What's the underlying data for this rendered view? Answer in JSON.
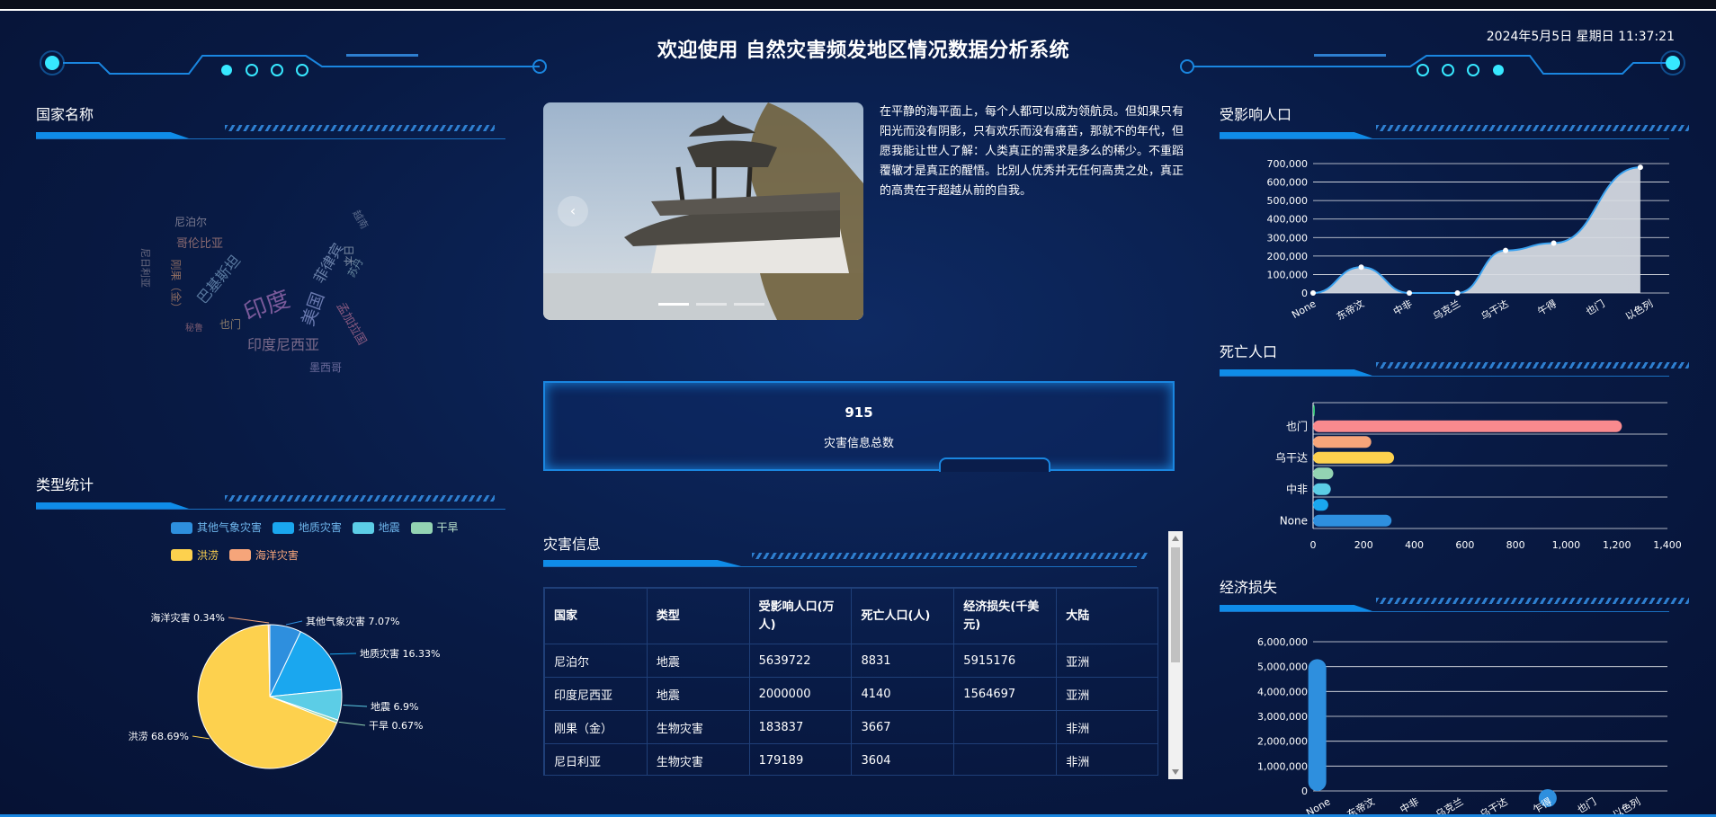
{
  "header": {
    "title": "欢迎使用 自然灾害频发地区情况数据分析系统",
    "datetime": "2024年5月5日 星期日 11:37:21"
  },
  "panels": {
    "country_title": "国家名称",
    "type_title": "类型统计",
    "affected_title": "受影响人口",
    "death_title": "死亡人口",
    "loss_title": "经济损失",
    "disaster_title": "灾害信息"
  },
  "wordcloud": [
    {
      "text": "印度",
      "color": "#7a5a9a"
    },
    {
      "text": "美国",
      "color": "#6a7ab0"
    },
    {
      "text": "印度尼西亚",
      "color": "#7a6a8a"
    },
    {
      "text": "菲律宾",
      "color": "#6a80a8"
    },
    {
      "text": "孟加拉国",
      "color": "#8a5a80"
    },
    {
      "text": "巴基斯坦",
      "color": "#5a7aa0"
    },
    {
      "text": "尼泊尔",
      "color": "#7a7a90"
    },
    {
      "text": "哥伦比亚",
      "color": "#8a6a70"
    },
    {
      "text": "墨西哥",
      "color": "#6a6a9a"
    },
    {
      "text": "也门",
      "color": "#8a7a6a"
    },
    {
      "text": "日本",
      "color": "#7a8aa0"
    },
    {
      "text": "苏丹",
      "color": "#6a8aa0"
    },
    {
      "text": "尼日利亚",
      "color": "#6a6a80"
    },
    {
      "text": "刚果（金）",
      "color": "#8a6a60"
    },
    {
      "text": "秘鲁",
      "color": "#7a5a70"
    },
    {
      "text": "越南",
      "color": "#5a6a8a"
    }
  ],
  "slide": {
    "text": "在平静的海平面上，每个人都可以成为领航员。但如果只有阳光而没有阴影，只有欢乐而没有痛苦，那就不的年代，但愿我能让世人了解：人类真正的需求是多么的稀少。不重蹈覆辙才是真正的醒悟。比别人优秀并无任何高贵之处，真正的高贵在于超越从前的自我。",
    "prev": "‹"
  },
  "counter": {
    "value": "915",
    "label": "灾害信息总数"
  },
  "table": {
    "headers": [
      "国家",
      "类型",
      "受影响人口(万人)",
      "死亡人口(人)",
      "经济损失(千美元)",
      "大陆"
    ],
    "rows": [
      [
        "尼泊尔",
        "地震",
        "5639722",
        "8831",
        "5915176",
        "亚洲"
      ],
      [
        "印度尼西亚",
        "地震",
        "2000000",
        "4140",
        "1564697",
        "亚洲"
      ],
      [
        "刚果（金）",
        "生物灾害",
        "183837",
        "3667",
        "",
        "非洲"
      ],
      [
        "尼日利亚",
        "生物灾害",
        "179189",
        "3604",
        "",
        "非洲"
      ]
    ]
  },
  "chart_data": [
    {
      "type": "pie",
      "title": "类型统计",
      "categories": [
        "其他气象灾害",
        "地质灾害",
        "地震",
        "干旱",
        "洪涝",
        "海洋灾害"
      ],
      "values": [
        7.07,
        16.33,
        6.9,
        0.67,
        68.69,
        0.34
      ],
      "labels": [
        "其他气象灾害 7.07%",
        "地质灾害 16.33%",
        "地震 6.9%",
        "干旱 0.67%",
        "洪涝 68.69%",
        "海洋灾害 0.34%"
      ],
      "colors": [
        "#2e8fde",
        "#1aa7ef",
        "#5ccde6",
        "#93d3b3",
        "#fdd14e",
        "#f6a57a"
      ],
      "legend_position": "top"
    },
    {
      "type": "area",
      "title": "受影响人口",
      "categories": [
        "None",
        "东帝汶",
        "中非",
        "乌克兰",
        "乌干达",
        "也门",
        "以色列"
      ],
      "x": [
        0,
        1,
        2,
        3,
        4,
        5,
        6,
        7,
        8,
        9
      ],
      "x_label_indices": [
        0,
        1,
        2,
        3,
        4,
        5,
        6,
        7
      ],
      "x_labels": [
        "None",
        "东帝汶",
        "中非",
        "乌克兰",
        "乌干达",
        "午得",
        "也门",
        "以色列"
      ],
      "values": [
        0,
        140000,
        0,
        0,
        230000,
        270000,
        680000
      ],
      "point_x": [
        0,
        1,
        2,
        3,
        4,
        5,
        6
      ],
      "ylim": [
        0,
        700000
      ],
      "yticks": [
        "0",
        "100,000",
        "200,000",
        "300,000",
        "400,000",
        "500,000",
        "600,000",
        "700,000"
      ],
      "grid": true
    },
    {
      "type": "bar",
      "orientation": "horizontal",
      "title": "死亡人口",
      "categories": [
        "None",
        "",
        "中非",
        "",
        "乌干达",
        "",
        "也门",
        ""
      ],
      "values": [
        310,
        60,
        70,
        80,
        320,
        230,
        1220,
        5
      ],
      "colors": [
        "#2e8fde",
        "#1aa7ef",
        "#5ccde6",
        "#93d3b3",
        "#fdd14e",
        "#f6a57a",
        "#f98a8e",
        "#37c97a"
      ],
      "xlim": [
        0,
        1400
      ],
      "xticks": [
        "0",
        "200",
        "400",
        "600",
        "800",
        "1,000",
        "1,200",
        "1,400"
      ],
      "grid": true
    },
    {
      "type": "bar",
      "title": "经济损失",
      "categories": [
        "None",
        "东帝汶",
        "中非",
        "乌克兰",
        "乌干达",
        "乍得",
        "也门",
        "以色列"
      ],
      "values": [
        5300000,
        0,
        0,
        0,
        0,
        60000,
        0,
        0
      ],
      "ylim": [
        0,
        6000000
      ],
      "yticks": [
        "0",
        "1,000,000",
        "2,000,000",
        "3,000,000",
        "4,000,000",
        "5,000,000",
        "6,000,000"
      ],
      "color": "#2e8fde",
      "grid": true
    }
  ]
}
